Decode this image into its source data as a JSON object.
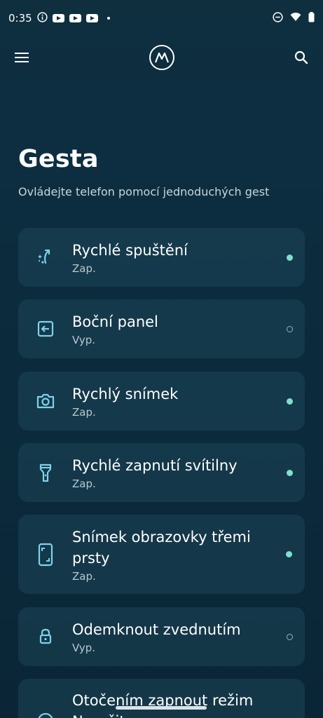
{
  "status_bar": {
    "time": "0:35"
  },
  "header": {
    "menu_icon": "hamburger-menu-icon",
    "logo_icon": "motorola-logo",
    "search_icon": "search-icon"
  },
  "page": {
    "title": "Gesta",
    "subtitle": "Ovládejte telefon pomocí jednoduchých gest"
  },
  "gestures": [
    {
      "label": "Rychlé spuštění",
      "state": "Zap.",
      "enabled": true,
      "icon": "quick-launch-icon"
    },
    {
      "label": "Boční panel",
      "state": "Vyp.",
      "enabled": false,
      "icon": "side-panel-icon"
    },
    {
      "label": "Rychlý snímek",
      "state": "Zap.",
      "enabled": true,
      "icon": "camera-icon"
    },
    {
      "label": "Rychlé zapnutí svítilny",
      "state": "Zap.",
      "enabled": true,
      "icon": "flashlight-icon"
    },
    {
      "label": "Snímek obrazovky třemi prsty",
      "state": "Zap.",
      "enabled": true,
      "icon": "screenshot-phone-icon"
    },
    {
      "label": "Odemknout zvednutím",
      "state": "Vyp.",
      "enabled": false,
      "icon": "lock-icon"
    },
    {
      "label": "Otočením zapnout režim Nerušit",
      "state": "",
      "enabled": false,
      "icon": "do-not-disturb-icon"
    }
  ],
  "colors": {
    "accent": "#7fe0cf",
    "icon": "#7fd2ea"
  }
}
